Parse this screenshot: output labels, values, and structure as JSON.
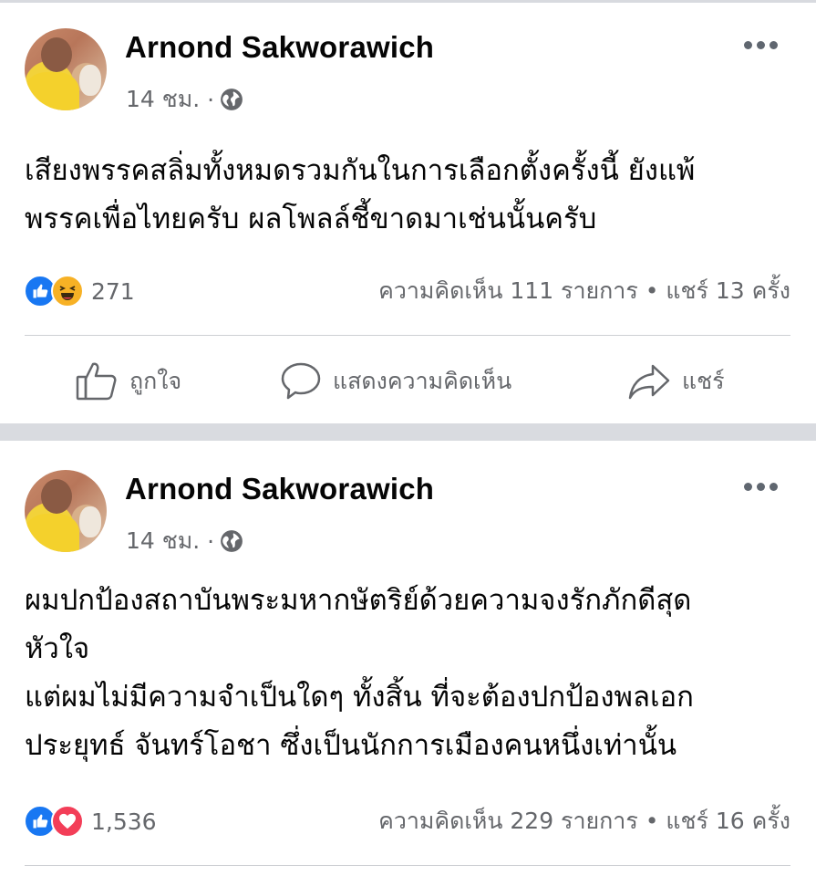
{
  "posts": [
    {
      "author": "Arnond Sakworawich",
      "time": "14 ชม.",
      "dot": "·",
      "text_lines": [
        "เสียงพรรคสลิ่มทั้งหมดรวมกันในการเลือกตั้งครั้งนี้ ยังแพ้",
        "พรรคเพื่อไทยครับ ผลโพลล์ชี้ขาดมาเช่นนั้นครับ"
      ],
      "reaction_count": "271",
      "reactions": [
        "like",
        "haha"
      ],
      "stats": "ความคิดเห็น 111 รายการ • แชร์ 13 ครั้ง",
      "actions": {
        "like": "ถูกใจ",
        "comment": "แสดงความคิดเห็น",
        "share": "แชร์"
      }
    },
    {
      "author": "Arnond Sakworawich",
      "time": "14 ชม.",
      "dot": "·",
      "text_lines": [
        "ผมปกป้องสถาบันพระมหากษัตริย์ด้วยความจงรักภักดีสุด",
        "หัวใจ",
        "แต่ผมไม่มีความจำเป็นใดๆ ทั้งสิ้น ที่จะต้องปกป้องพลเอก",
        "ประยุทธ์ จันทร์โอชา ซึ่งเป็นนักการเมืองคนหนึ่งเท่านั้น"
      ],
      "reaction_count": "1,536",
      "reactions": [
        "like",
        "love"
      ],
      "stats": "ความคิดเห็น 229 รายการ • แชร์ 16 ครั้ง"
    }
  ],
  "colors": {
    "primary_text": "#050505",
    "secondary_text": "#65676b",
    "like_blue": "#1877f2",
    "love_red": "#f33e58",
    "haha_yellow": "#f7b125",
    "divider": "#d9dbe0"
  }
}
